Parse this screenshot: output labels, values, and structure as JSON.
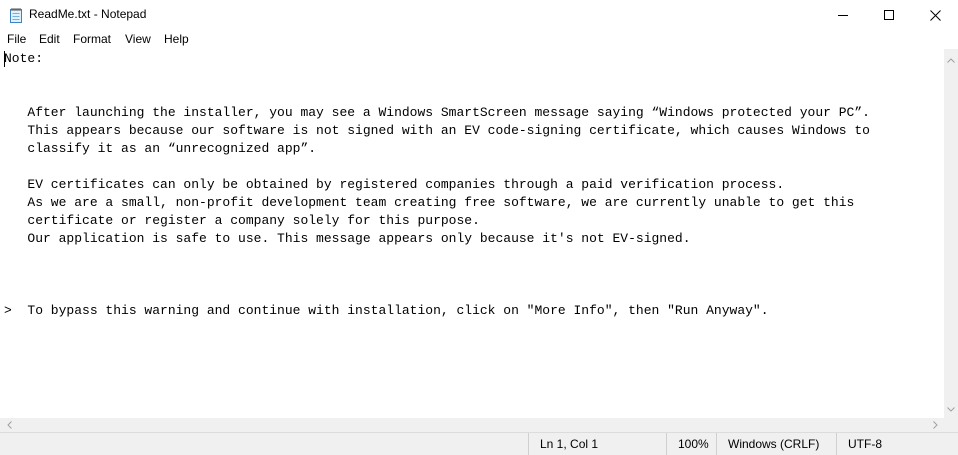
{
  "window": {
    "title": "ReadMe.txt - Notepad",
    "app_icon": "notepad-icon",
    "controls": [
      "minimize-icon",
      "maximize-icon",
      "close-icon"
    ]
  },
  "menu": {
    "items": [
      {
        "label": "File"
      },
      {
        "label": "Edit"
      },
      {
        "label": "Format"
      },
      {
        "label": "View"
      },
      {
        "label": "Help"
      }
    ]
  },
  "editor": {
    "content": "Note:\n\n\n   After launching the installer, you may see a Windows SmartScreen message saying “Windows protected your PC”.\n   This appears because our software is not signed with an EV code-signing certificate, which causes Windows to\n   classify it as an “unrecognized app”.\n\n   EV certificates can only be obtained by registered companies through a paid verification process.\n   As we are a small, non-profit development team creating free software, we are currently unable to get this\n   certificate or register a company solely for this purpose.\n   Our application is safe to use. This message appears only because it's not EV-signed.\n\n\n\n>  To bypass this warning and continue with installation, click on \"More Info\", then \"Run Anyway\"."
  },
  "status": {
    "position": "Ln 1, Col 1",
    "zoom": "100%",
    "line_ending": "Windows (CRLF)",
    "encoding": "UTF-8"
  }
}
